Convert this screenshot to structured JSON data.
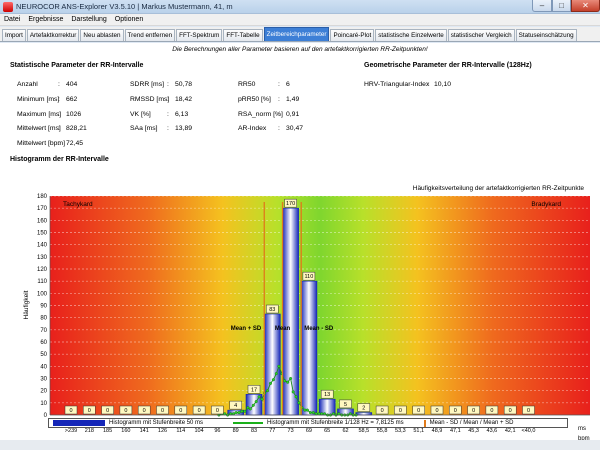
{
  "window": {
    "title": "NEUROCOR ANS-Explorer V3.5.10  | Markus Mustermann, 41, m",
    "min_glyph": "–",
    "max_glyph": "□",
    "close_glyph": "✕"
  },
  "menu": [
    "Datei",
    "Ergebnisse",
    "Darstellung",
    "Optionen"
  ],
  "tabs": [
    "Import",
    "Artefaktkorrektur",
    "Neu ablasten",
    "Trend entfernen",
    "FFT-Spektrum",
    "FFT-Tabelle",
    "Zeitbereichparameter",
    "Poincaré-Plot",
    "statistische Einzelwerte",
    "statistischer Vergleich",
    "Statuseinschätzung"
  ],
  "active_tab": 6,
  "note": "Die Berechnungen aller Parameter basieren auf den artefaktkorrigierten RR-Zeitpunkten!",
  "stats": {
    "heading": "Statistische Parameter der RR-Intervalle",
    "col1": [
      {
        "label": "Anzahl",
        "value": "404"
      },
      {
        "label": "Minimum [ms]",
        "value": "662"
      },
      {
        "label": "Maximum [ms]",
        "value": "1026"
      },
      {
        "label": "Mittelwert [ms]",
        "value": "828,21"
      },
      {
        "label": "Mittelwert [bpm]",
        "value": "72,45"
      }
    ],
    "col2": [
      {
        "label": "SDRR [ms]",
        "value": "50,78"
      },
      {
        "label": "RMSSD [ms]",
        "value": "18,42"
      },
      {
        "label": "VK [%]",
        "value": "6,13"
      },
      {
        "label": "SAa [ms]",
        "value": "13,89"
      }
    ],
    "col3": [
      {
        "label": "RR50",
        "value": "6"
      },
      {
        "label": "pRR50 [%]",
        "value": "1,49"
      },
      {
        "label": "RSA_norm [%]",
        "value": "0,91"
      },
      {
        "label": "AR-Index",
        "value": "30,47"
      }
    ]
  },
  "geo": {
    "heading": "Geometrische Parameter der RR-Intervalle (128Hz)",
    "items": [
      {
        "label": "HRV-Triangular-Index",
        "value": "10,10"
      }
    ]
  },
  "histogram_heading": "Histogramm der RR-Intervalle",
  "chart_data": {
    "type": "bar",
    "title": "Häufigkeitsverteilung der artefaktkorrigierten RR-Zeitpunkte",
    "ylabel": "Häufigkeit",
    "ylim": [
      0,
      180
    ],
    "y_ticks": [
      0,
      10,
      20,
      30,
      40,
      50,
      60,
      70,
      80,
      90,
      100,
      110,
      120,
      130,
      140,
      150,
      160,
      170,
      180
    ],
    "left_zone_label": "Tachykard",
    "right_zone_label": "Bradykard",
    "categories_ms": [
      "<251",
      "275",
      "325",
      "375",
      "425",
      "475",
      "525",
      "575",
      "625",
      "675",
      "725",
      "775",
      "825",
      "875",
      "925",
      "975",
      "1025",
      "1075",
      "1125",
      "1175",
      "1225",
      "1275",
      "1325",
      "1375",
      "1425",
      ">1499"
    ],
    "categories_bpm": [
      ">239",
      "218",
      "185",
      "160",
      "141",
      "126",
      "114",
      "104",
      "96",
      "89",
      "83",
      "77",
      "73",
      "69",
      "65",
      "62",
      "58,5",
      "55,8",
      "53,3",
      "51,1",
      "48,9",
      "47,1",
      "45,3",
      "43,6",
      "42,1",
      "<40,0"
    ],
    "x_unit_ms": "ms",
    "x_unit_bpm": "bpm",
    "values": [
      0,
      0,
      0,
      0,
      0,
      0,
      0,
      0,
      0,
      4,
      17,
      83,
      170,
      110,
      13,
      5,
      2,
      0,
      0,
      0,
      0,
      0,
      0,
      0,
      0,
      0
    ],
    "fine_series": {
      "name": "Histogramm mit Stufenbreite 1/128 Hz = 7,8125 ms",
      "x": [
        654,
        662,
        670,
        678,
        686,
        694,
        701,
        709,
        717,
        725,
        733,
        740,
        748,
        756,
        764,
        772,
        779,
        787,
        795,
        803,
        811,
        818,
        826,
        834,
        842,
        850,
        857,
        865,
        873,
        881,
        889,
        896,
        904,
        912,
        920,
        928,
        935,
        943,
        951,
        959,
        967,
        974,
        982,
        990,
        998,
        1006,
        1013,
        1021,
        1029
      ],
      "y": [
        0,
        1,
        1,
        0,
        1,
        1,
        2,
        2,
        3,
        3,
        6,
        5,
        8,
        11,
        15,
        13,
        18,
        20,
        26,
        29,
        34,
        40,
        34,
        28,
        27,
        30,
        19,
        15,
        10,
        6,
        4,
        4,
        2,
        2,
        1,
        1,
        1,
        1,
        0,
        0,
        1,
        0,
        1,
        0,
        0,
        0,
        1,
        0,
        0
      ]
    },
    "mean_lines": [
      {
        "label": "Mean + SD",
        "value_ms": 778
      },
      {
        "label": "Mean",
        "value_ms": 828
      },
      {
        "label": "Mean - SD",
        "value_ms": 879
      }
    ],
    "legend": [
      {
        "name": "Histogramm mit Stufenbreite 50 ms",
        "kind": "bar",
        "color": "#1426b8"
      },
      {
        "name": "Histogramm mit Stufenbreite 1/128 Hz = 7,8125 ms",
        "kind": "line",
        "color": "#1ab01a"
      },
      {
        "name": "Mean - SD / Mean / Mean + SD",
        "kind": "vline",
        "color": "#e07a1a"
      }
    ],
    "grid": true,
    "legend_position": "bottom"
  }
}
